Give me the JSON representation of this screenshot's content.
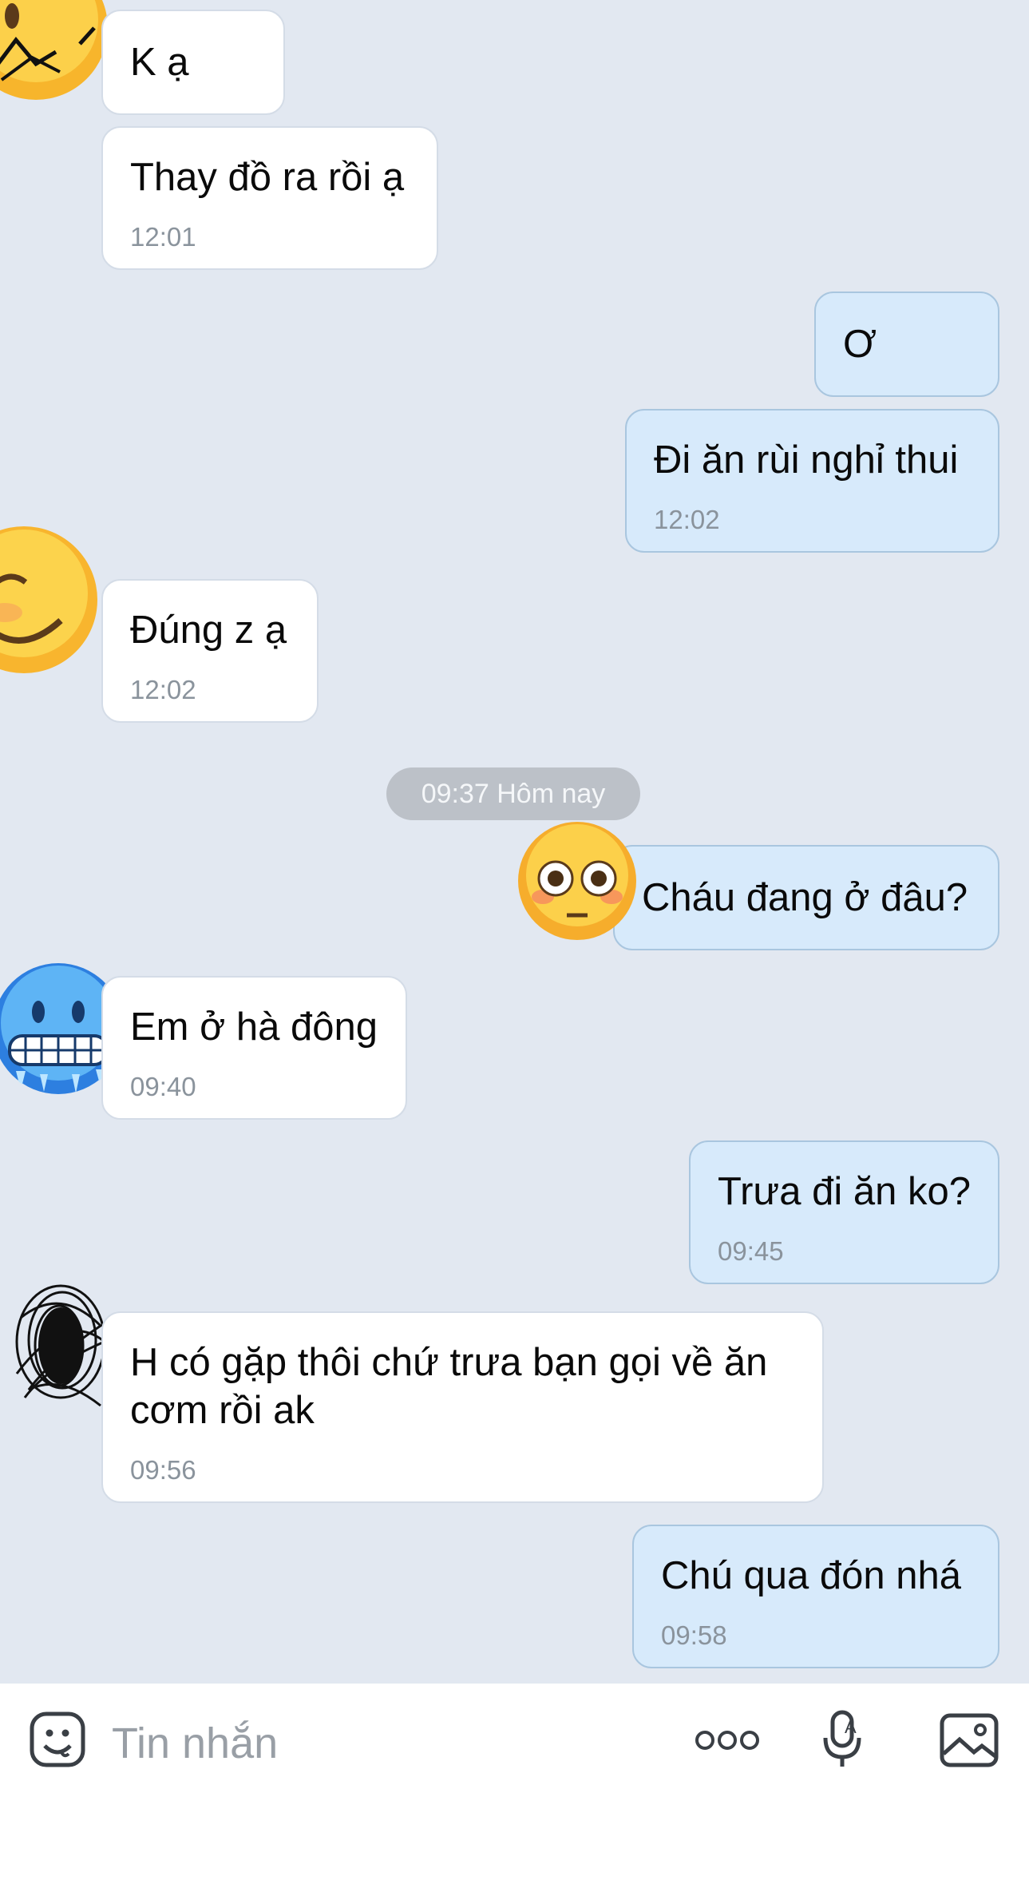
{
  "messages": [
    {
      "text": "K ạ",
      "time": ""
    },
    {
      "text": "Thay đồ ra rồi ạ",
      "time": "12:01"
    },
    {
      "text": "Ơ",
      "time": ""
    },
    {
      "text": "Đi ăn rùi nghỉ thui",
      "time": "12:02"
    },
    {
      "text": "Đúng z ạ",
      "time": "12:02"
    },
    {
      "text": "Cháu đang ở đâu?",
      "time": ""
    },
    {
      "text": "Em ở hà đông",
      "time": "09:40"
    },
    {
      "text": "Trưa đi ăn ko?",
      "time": "09:45"
    },
    {
      "text": "H có gặp thôi chứ trưa bạn gọi về ăn",
      "text2": "cơm rồi ak",
      "time": "09:56"
    },
    {
      "text": "Chú qua đón nhá",
      "time": "09:58"
    }
  ],
  "date_separator": "09:37 Hôm nay",
  "composer": {
    "placeholder": "Tin nhắn",
    "icons": [
      "sticker-icon",
      "more-icon",
      "voice-icon",
      "image-icon"
    ]
  },
  "colors": {
    "background": "#e2e8f1",
    "incoming_bubble": "#ffffff",
    "outgoing_bubble": "#d7eafb"
  }
}
